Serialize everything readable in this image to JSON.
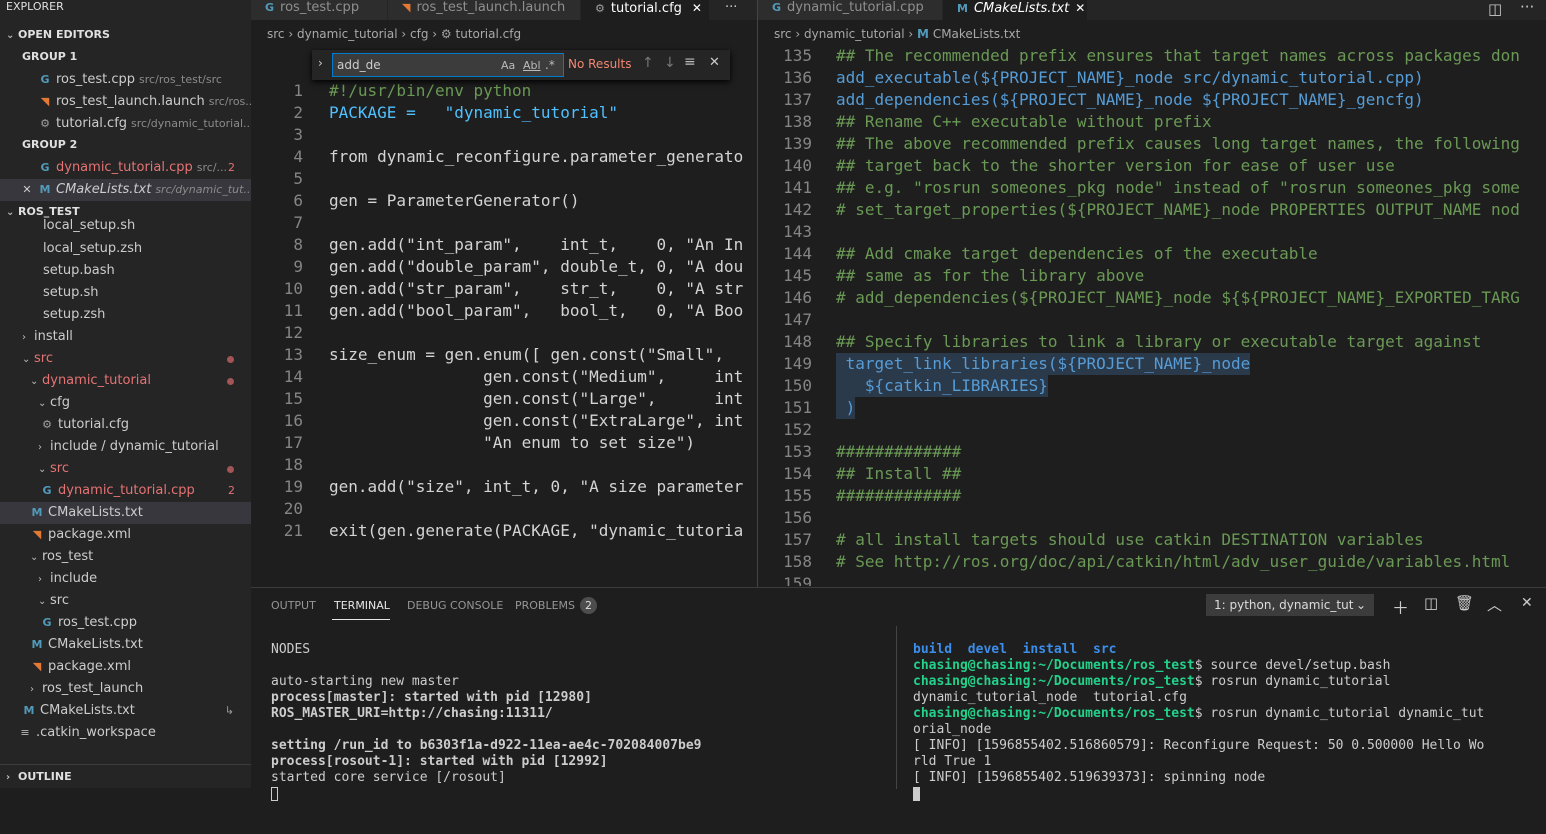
{
  "sidebar": {
    "explorer_title": "EXPLORER",
    "open_editors_title": "OPEN EDITORS",
    "group1_title": "GROUP 1",
    "group2_title": "GROUP 2",
    "project_title": "ROS_TEST",
    "outline_title": "OUTLINE",
    "open_editors": [
      {
        "name": "ros_test.cpp",
        "desc": "src/ros_test/src"
      },
      {
        "name": "ros_test_launch.launch",
        "desc": "src/ros..."
      },
      {
        "name": "tutorial.cfg",
        "desc": "src/dynamic_tutorial..."
      },
      {
        "name": "dynamic_tutorial.cpp",
        "desc": "src/...",
        "badge": "2"
      },
      {
        "name": "CMakeLists.txt",
        "desc": "src/dynamic_tut..."
      }
    ],
    "tree": [
      {
        "label": "local_setup.sh"
      },
      {
        "label": "local_setup.zsh"
      },
      {
        "label": "setup.bash"
      },
      {
        "label": "setup.sh"
      },
      {
        "label": "setup.zsh"
      },
      {
        "label": "install"
      },
      {
        "label": "src"
      },
      {
        "label": "dynamic_tutorial"
      },
      {
        "label": "cfg"
      },
      {
        "label": "tutorial.cfg"
      },
      {
        "label": "include / dynamic_tutorial"
      },
      {
        "label": "src"
      },
      {
        "label": "dynamic_tutorial.cpp",
        "badge": "2"
      },
      {
        "label": "CMakeLists.txt"
      },
      {
        "label": "package.xml"
      },
      {
        "label": "ros_test"
      },
      {
        "label": "include"
      },
      {
        "label": "src"
      },
      {
        "label": "ros_test.cpp"
      },
      {
        "label": "CMakeLists.txt"
      },
      {
        "label": "package.xml"
      },
      {
        "label": "ros_test_launch"
      },
      {
        "label": "CMakeLists.txt"
      },
      {
        "label": ".catkin_workspace"
      }
    ]
  },
  "left_editor": {
    "tabs": [
      "ros_test.cpp",
      "ros_test_launch.launch",
      "tutorial.cfg"
    ],
    "more_label": "···",
    "breadcrumb": [
      "src",
      "dynamic_tutorial",
      "cfg",
      "tutorial.cfg"
    ],
    "find": {
      "value": "add_de",
      "opt_case": "Aa",
      "opt_word": "Abl",
      "opt_regex": ".*",
      "result": "No Results"
    },
    "line_numbers": [
      "1",
      "2",
      "3",
      "4",
      "5",
      "6",
      "7",
      "8",
      "9",
      "10",
      "11",
      "12",
      "13",
      "14",
      "15",
      "16",
      "17",
      "18",
      "19",
      "20",
      "21"
    ],
    "lines": [
      "#!/usr/bin/env python",
      "PACKAGE =   \"dynamic_tutorial\"",
      "",
      "from dynamic_reconfigure.parameter_generato",
      "",
      "gen = ParameterGenerator()",
      "",
      "gen.add(\"int_param\",    int_t,    0, \"An In",
      "gen.add(\"double_param\", double_t, 0, \"A dou",
      "gen.add(\"str_param\",    str_t,    0, \"A str",
      "gen.add(\"bool_param\",   bool_t,   0, \"A Boo",
      "",
      "size_enum = gen.enum([ gen.const(\"Small\",",
      "                gen.const(\"Medium\",     int",
      "                gen.const(\"Large\",      int",
      "                gen.const(\"ExtraLarge\", int",
      "                \"An enum to set size\")",
      "",
      "gen.add(\"size\", int_t, 0, \"A size parameter",
      "",
      "exit(gen.generate(PACKAGE, \"dynamic_tutoria"
    ]
  },
  "right_editor": {
    "tabs": [
      "dynamic_tutorial.cpp",
      "CMakeLists.txt"
    ],
    "breadcrumb": [
      "src",
      "dynamic_tutorial",
      "CMakeLists.txt"
    ],
    "line_numbers": [
      "135",
      "136",
      "137",
      "138",
      "139",
      "140",
      "141",
      "142",
      "143",
      "144",
      "145",
      "146",
      "147",
      "148",
      "149",
      "150",
      "151",
      "152",
      "153",
      "154",
      "155",
      "156",
      "157",
      "158",
      "159"
    ],
    "lines": [
      "## The recommended prefix ensures that target names across packages don",
      "add_executable(${PROJECT_NAME}_node src/dynamic_tutorial.cpp)",
      "add_dependencies(${PROJECT_NAME}_node ${PROJECT_NAME}_gencfg)",
      "## Rename C++ executable without prefix",
      "## The above recommended prefix causes long target names, the following",
      "## target back to the shorter version for ease of user use",
      "## e.g. \"rosrun someones_pkg node\" instead of \"rosrun someones_pkg some",
      "# set_target_properties(${PROJECT_NAME}_node PROPERTIES OUTPUT_NAME nod",
      "",
      "## Add cmake target dependencies of the executable",
      "## same as for the library above",
      "# add_dependencies(${PROJECT_NAME}_node ${${PROJECT_NAME}_EXPORTED_TARG",
      "",
      "## Specify libraries to link a library or executable target against",
      " target_link_libraries(${PROJECT_NAME}_node",
      "   ${catkin_LIBRARIES}",
      " )",
      "",
      "#############",
      "## Install ##",
      "#############",
      "",
      "# all install targets should use catkin DESTINATION variables",
      "# See http://ros.org/doc/api/catkin/html/adv_user_guide/variables.html",
      ""
    ]
  },
  "panel": {
    "tabs": [
      "OUTPUT",
      "TERMINAL",
      "DEBUG CONSOLE",
      "PROBLEMS"
    ],
    "problems_count": "2",
    "terminal_select": "1: python, dynamic_tut",
    "left_terminal": [
      "NODES",
      "",
      "auto-starting new master",
      "process[master]: started with pid [12980]",
      "ROS_MASTER_URI=http://chasing:11311/",
      "",
      "setting /run_id to b6303f1a-d922-11ea-ae4c-702084007be9",
      "process[rosout-1]: started with pid [12992]",
      "started core service [/rosout]"
    ],
    "right_terminal": {
      "dirs": "build  devel  install  src",
      "prompt": "chasing@chasing:~/Documents/ros_test",
      "cmd1": "$ source devel/setup.bash",
      "cmd2": "$ rosrun dynamic_tutorial",
      "out1": "dynamic_tutorial_node  tutorial.cfg",
      "cmd3": "$ rosrun dynamic_tutorial dynamic_tut",
      "out2": "orial_node",
      "out3": "[ INFO] [1596855402.516860579]: Reconfigure Request: 50 0.500000 Hello Wo",
      "out4": "rld True 1",
      "out5": "[ INFO] [1596855402.519639373]: spinning node"
    }
  },
  "colors": {
    "accent": "#007acc",
    "background": "#1e1e1e",
    "sidebar": "#252526",
    "comment": "#6a9955",
    "keyword": "#569cd6",
    "string": "#ce9178"
  }
}
